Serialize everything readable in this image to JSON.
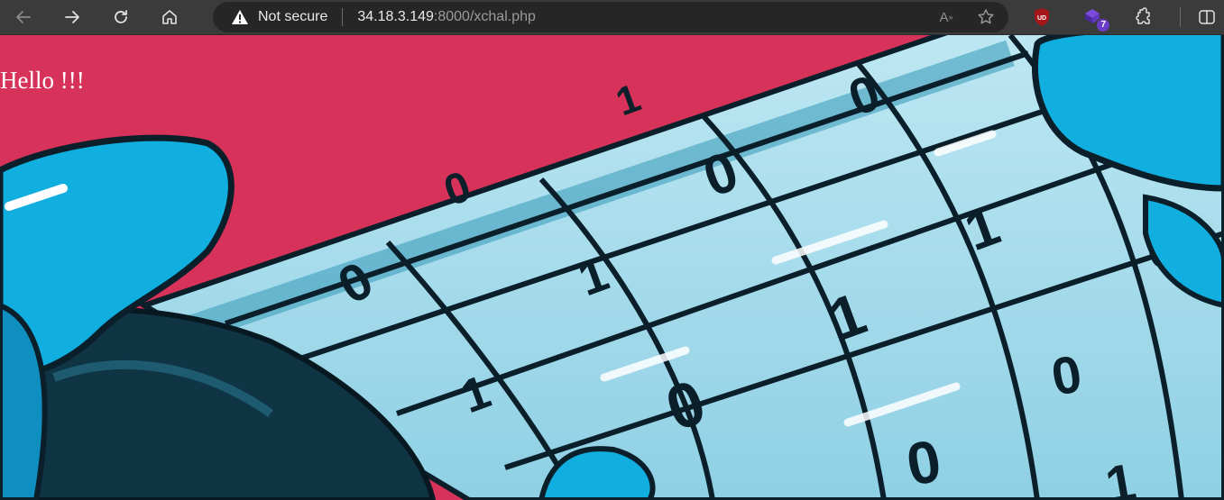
{
  "browser": {
    "security_label": "Not secure",
    "url_host": "34.18.3.149",
    "url_rest": ":8000/xchal.php",
    "icons": [
      "back-icon",
      "forward-icon",
      "refresh-icon",
      "home-icon",
      "warning-icon",
      "read-aloud-icon",
      "favorite-star-icon",
      "ublock-icon",
      "extension-purple-icon",
      "extensions-puzzle-icon",
      "split-screen-icon"
    ],
    "ext_badge": "7",
    "ublock_label": "UD"
  },
  "page": {
    "greeting": "Hello !!!",
    "background_color": "#d6325a",
    "image_digits": [
      "0",
      "1",
      "0",
      "0",
      "1",
      "1",
      "0",
      "1",
      "0",
      "1",
      "0",
      "1",
      "0",
      "0"
    ]
  }
}
